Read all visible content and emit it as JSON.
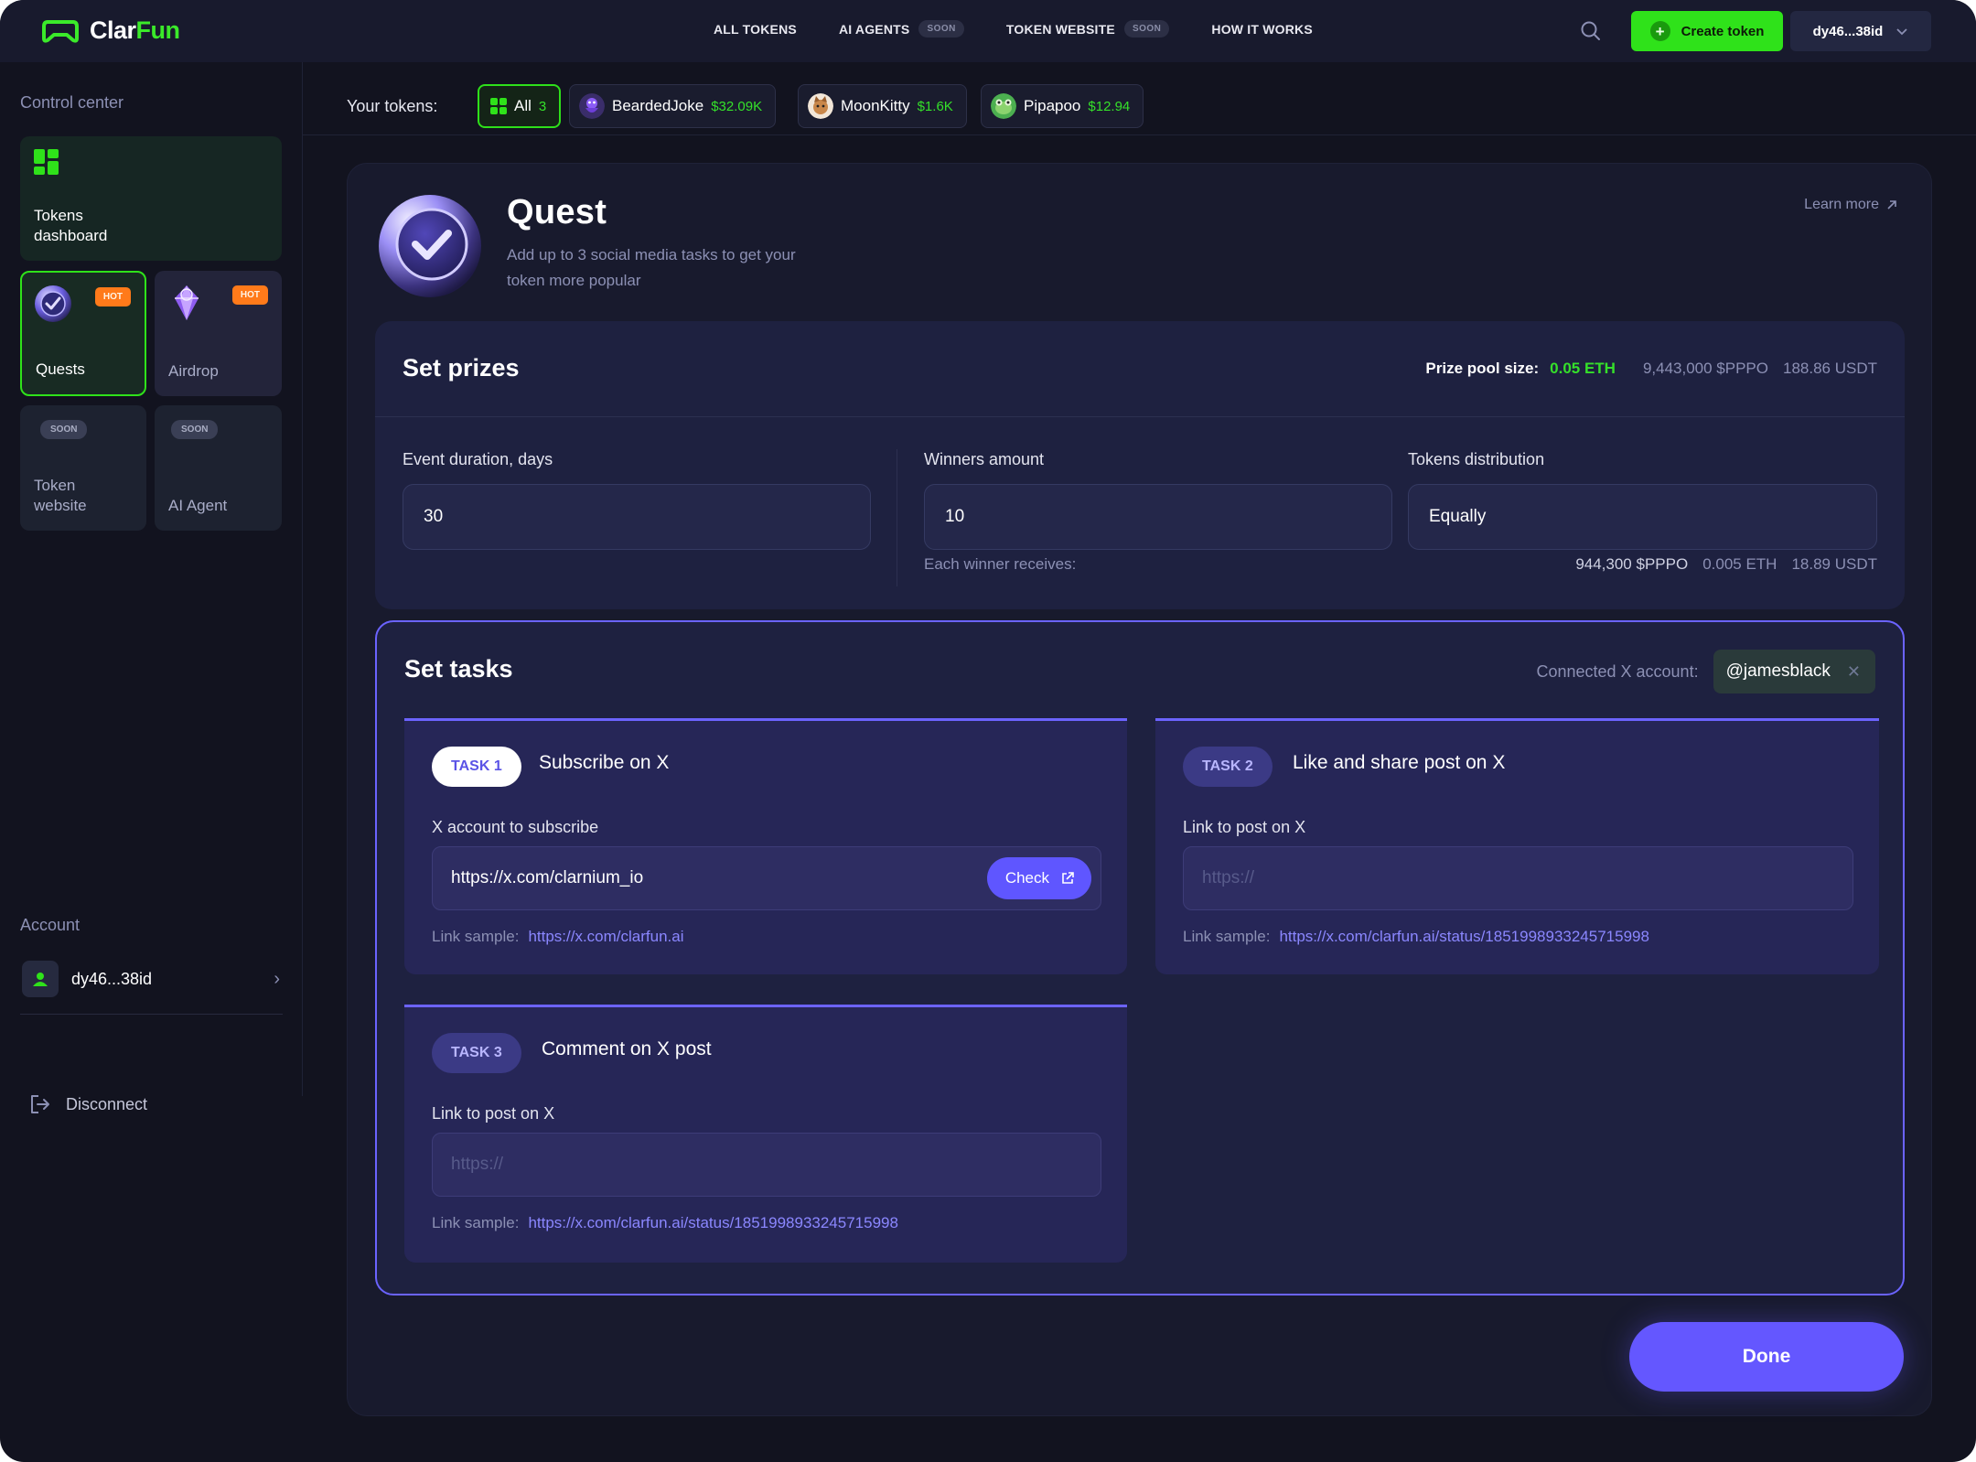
{
  "brand": {
    "name_part1": "Clar",
    "name_part2": "Fun",
    "accent": "#3bea2a"
  },
  "nav": {
    "items": [
      {
        "label": "ALL TOKENS",
        "badge": ""
      },
      {
        "label": "AI AGENTS",
        "badge": "SOON"
      },
      {
        "label": "TOKEN WEBSITE",
        "badge": "SOON"
      },
      {
        "label": "HOW IT WORKS",
        "badge": ""
      }
    ],
    "search_icon": "search-icon",
    "create_label": "Create token",
    "wallet_label": "dy46...38id"
  },
  "sidebar": {
    "heading": "Control center",
    "tiles": {
      "dashboard": "Tokens\ndashboard",
      "quests": "Quests",
      "quests_badge": "HOT",
      "airdrop": "Airdrop",
      "airdrop_badge": "HOT",
      "website": "Token\nwebsite",
      "website_badge": "SOON",
      "agent": "AI Agent",
      "agent_badge": "SOON"
    },
    "account_heading": "Account",
    "account_name": "dy46...38id",
    "disconnect_label": "Disconnect"
  },
  "tokens": {
    "label": "Your tokens:",
    "all": {
      "label": "All",
      "count": "3"
    },
    "items": [
      {
        "name": "BeardedJoke",
        "value": "$32.09K"
      },
      {
        "name": "MoonKitty",
        "value": "$1.6K"
      },
      {
        "name": "Pipapoo",
        "value": "$12.94"
      }
    ]
  },
  "quest": {
    "title": "Quest",
    "description": "Add up to 3 social media tasks to get your token more popular",
    "learn_more": "Learn more"
  },
  "prizes": {
    "title": "Set prizes",
    "pool_label": "Prize pool size:",
    "pool_eth": "0.05 ETH",
    "pool_token": "9,443,000 $PPPO",
    "pool_usdt": "188.86 USDT",
    "duration_label": "Event duration, days",
    "duration_value": "30",
    "winners_label": "Winners amount",
    "winners_value": "10",
    "distribution_label": "Tokens distribution",
    "distribution_value": "Equally",
    "each_label": "Each winner receives:",
    "each_token": "944,300 $PPPO",
    "each_eth": "0.005 ETH",
    "each_usdt": "18.89 USDT"
  },
  "tasks": {
    "title": "Set tasks",
    "connected_label": "Connected X account:",
    "connected_handle": "@jamesblack",
    "list": [
      {
        "tag": "TASK 1",
        "title": "Subscribe on X",
        "field_label": "X account to subscribe",
        "value": "https://x.com/clarnium_io",
        "placeholder": "",
        "check_label": "Check",
        "sample_label": "Link sample:",
        "sample_link": "https://x.com/clarfun.ai"
      },
      {
        "tag": "TASK 2",
        "title": "Like and share post on X",
        "field_label": "Link to post on X",
        "value": "",
        "placeholder": "https://",
        "sample_label": "Link sample:",
        "sample_link": "https://x.com/clarfun.ai/status/1851998933245715998"
      },
      {
        "tag": "TASK 3",
        "title": "Comment on X post",
        "field_label": "Link to post on X",
        "value": "",
        "placeholder": "https://",
        "sample_label": "Link sample:",
        "sample_link": "https://x.com/clarfun.ai/status/1851998933245715998"
      }
    ]
  },
  "done_label": "Done",
  "colors": {
    "background": "#12131f",
    "panel": "#181a2d",
    "green": "#2fe21a",
    "purple": "#6457ff"
  }
}
